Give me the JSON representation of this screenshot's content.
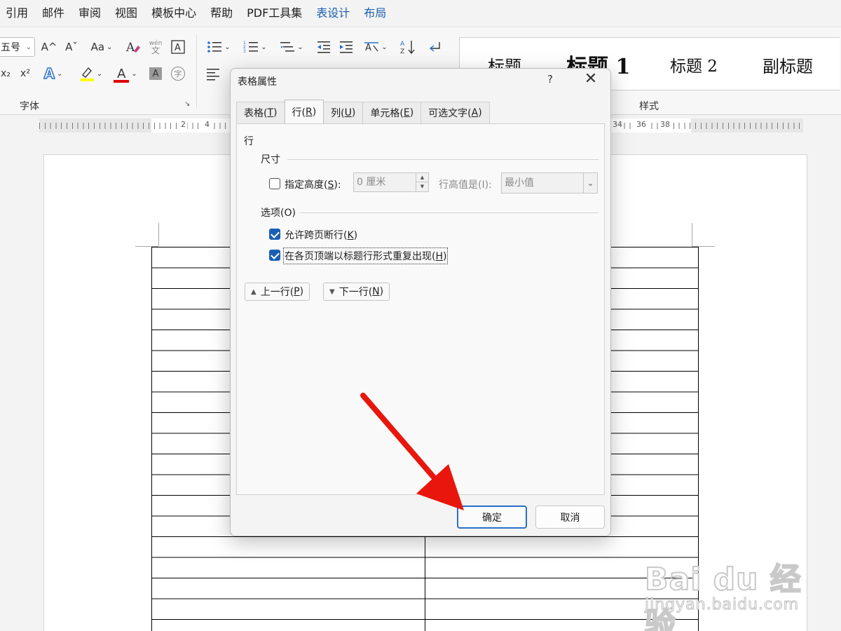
{
  "menubar": {
    "items": [
      "引用",
      "邮件",
      "审阅",
      "视图",
      "模板中心",
      "帮助",
      "PDF工具集",
      "表设计",
      "布局"
    ]
  },
  "ribbon": {
    "font_size": "五号",
    "group_font": "字体",
    "group_styles": "样式",
    "btn_grow": "A^",
    "btn_shrink": "Aˇ",
    "btn_case": "Aa",
    "btn_phonetic_top": "wén",
    "btn_phonetic_bottom": "文",
    "btn_subscript": "x₂",
    "btn_superscript": "x²",
    "btn_text_effect": "A",
    "btn_font_color": "A",
    "btn_shading": "A",
    "btn_enclose": "字",
    "styles": [
      "标题",
      "标题 1",
      "标题 2",
      "副标题"
    ],
    "colors": {
      "highlight": "#ffff00",
      "font_color": "#e00000",
      "accent": "#1b5fb0"
    }
  },
  "ruler": {
    "numbers": [
      "2",
      "4",
      "34",
      "36",
      "38"
    ]
  },
  "dialog": {
    "title": "表格属性",
    "help": "?",
    "close": "✕",
    "tabs": [
      {
        "text": "表格(",
        "key": "T",
        "end": ")"
      },
      {
        "text": "行(",
        "key": "R",
        "end": ")"
      },
      {
        "text": "列(",
        "key": "U",
        "end": ")"
      },
      {
        "text": "单元格(",
        "key": "E",
        "end": ")"
      },
      {
        "text": "可选文字(",
        "key": "A",
        "end": ")"
      }
    ],
    "section_row": "行",
    "section_size": "尺寸",
    "specify_height": {
      "text": "指定高度(",
      "key": "S",
      "end": "):",
      "checked": false
    },
    "height_value": "0 厘米",
    "row_height_is": "行高值是(I):",
    "row_height_option": "最小值",
    "section_options": "选项(O)",
    "allow_break": {
      "text": "允许跨页断行(",
      "key": "K",
      "end": ")",
      "checked": true
    },
    "repeat_header": {
      "text": "在各页顶端以标题行形式重复出现(",
      "key": "H",
      "end": ")",
      "checked": true
    },
    "prev_row": {
      "text": "上一行(",
      "key": "P",
      "end": ")"
    },
    "next_row": {
      "text": "下一行(",
      "key": "N",
      "end": ")"
    },
    "ok": "确定",
    "cancel": "取消"
  },
  "watermark": {
    "main": "Bai du 经验",
    "sub": "jingyan.baidu.com"
  }
}
